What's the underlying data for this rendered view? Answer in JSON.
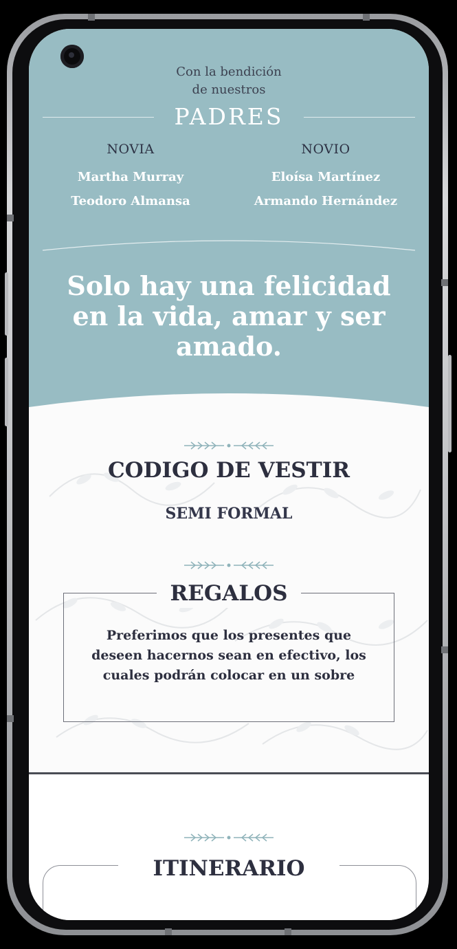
{
  "blessing": {
    "line1": "Con la bendición",
    "line2": "de nuestros"
  },
  "padres_title": "PADRES",
  "bride": {
    "heading": "NOVIA",
    "names": [
      "Martha Murray",
      "Teodoro Almansa"
    ]
  },
  "groom": {
    "heading": "NOVIO",
    "names": [
      "Eloísa Martínez",
      "Armando Hernández"
    ]
  },
  "quote": "Solo hay una felicidad en la vida, amar y ser amado.",
  "dress_code": {
    "title": "CODIGO DE VESTIR",
    "value": "SEMI FORMAL"
  },
  "gifts": {
    "title": "REGALOS",
    "text": "Preferimos que los presentes que deseen hacernos sean en efectivo, los cuales podrán colocar en un sobre"
  },
  "itinerary": {
    "title": "ITINERARIO"
  },
  "colors": {
    "teal": "#98bcc3",
    "dark_text": "#2d2f3f",
    "accent_ornament": "#8fb3ba"
  },
  "icons": {
    "ornament": "arrow-ornament-icon",
    "camera": "front-camera-icon"
  }
}
